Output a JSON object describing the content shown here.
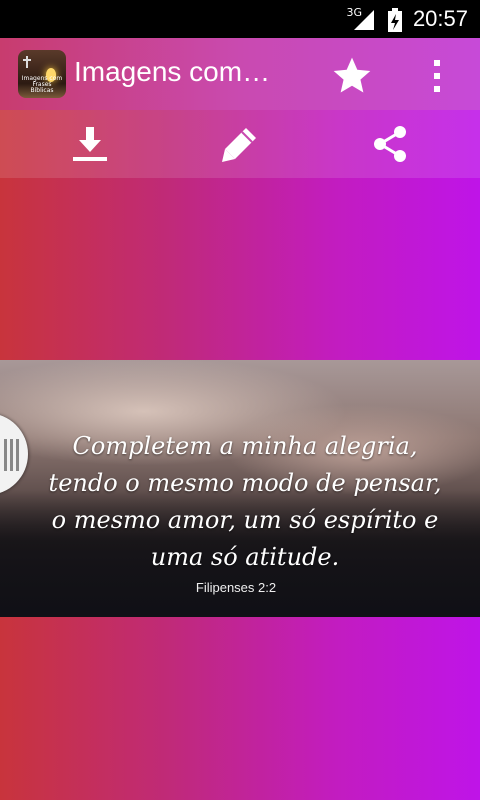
{
  "status_bar": {
    "network": "3G",
    "time": "20:57"
  },
  "app_bar": {
    "title": "Imagens com…",
    "icon_caption": "Imagens com Frases Bíblicas"
  },
  "toolbar": {
    "icons": [
      "download-icon",
      "pencil-icon",
      "share-icon"
    ]
  },
  "content": {
    "quote_lines": [
      "Completem a minha alegria,",
      "tendo o mesmo modo de pensar,",
      "o mesmo amor, um só espírito e",
      "uma só atitude."
    ],
    "reference": "Filipenses 2:2"
  },
  "colors": {
    "gradient_left": "#c8343c",
    "gradient_right": "#bf14e8",
    "status_bar": "#000000"
  }
}
